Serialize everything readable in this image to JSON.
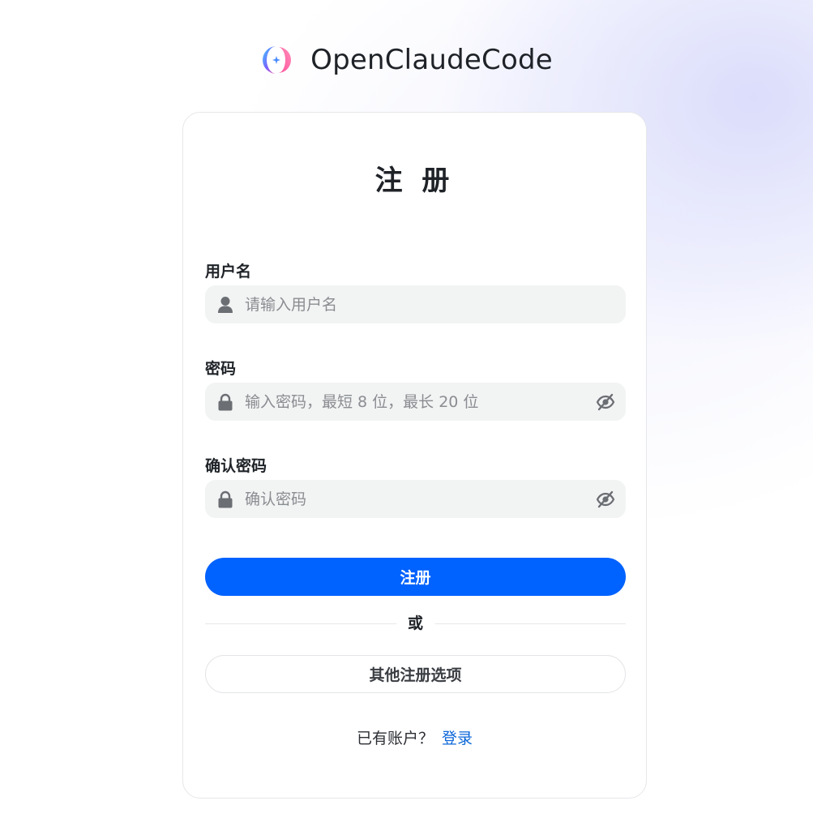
{
  "brand": {
    "name": "OpenClaudeCode",
    "logo_icon": "brand-logo-icon",
    "logo_colors": [
      "#3fd0ff",
      "#7a5cff",
      "#ff5fa8"
    ]
  },
  "form": {
    "title": "注 册",
    "fields": [
      {
        "label": "用户名",
        "placeholder": "请输入用户名",
        "value": "",
        "icon": "user-icon"
      },
      {
        "label": "密码",
        "placeholder": "输入密码，最短 8 位，最长 20 位",
        "value": "",
        "icon": "lock-icon",
        "toggle_icon": "eye-off-icon"
      },
      {
        "label": "确认密码",
        "placeholder": "确认密码",
        "value": "",
        "icon": "lock-icon",
        "toggle_icon": "eye-off-icon"
      }
    ],
    "submit_label": "注册",
    "divider_text": "或",
    "other_options_label": "其他注册选项",
    "footer_prompt": "已有账户？",
    "login_link": "登录"
  },
  "colors": {
    "primary": "#0062ff",
    "link": "#0a66d8",
    "input_bg": "#f2f3f3",
    "text": "#1f2328"
  }
}
